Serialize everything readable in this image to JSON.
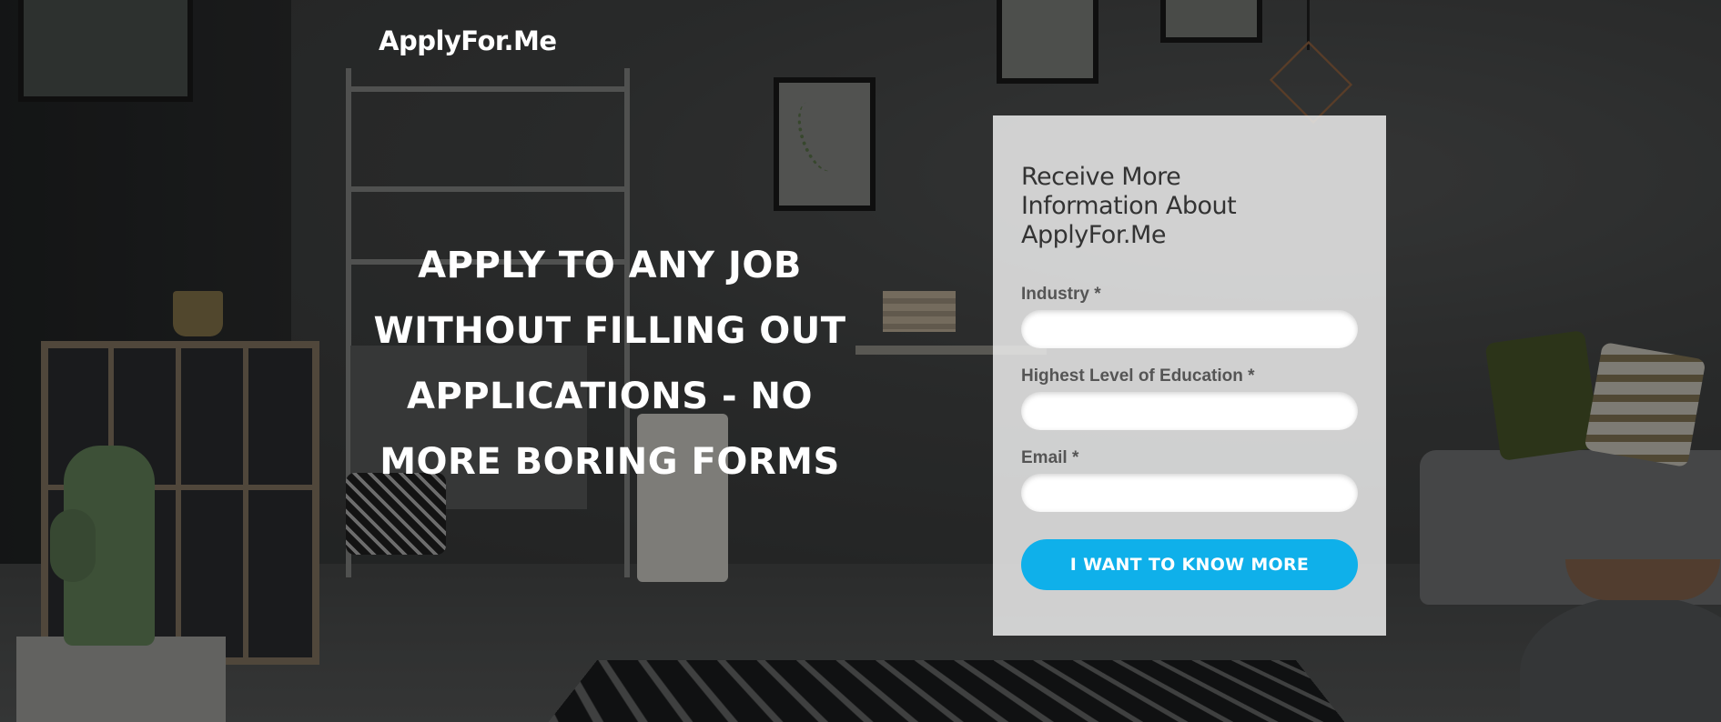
{
  "brand": {
    "logo_text": "ApplyFor.Me"
  },
  "hero": {
    "headline": "APPLY TO ANY JOB WITHOUT FILLING OUT APPLICATIONS - NO MORE BORING FORMS",
    "background_image": "living room interior with shelves, plants, cactus, sofa and patterned rug"
  },
  "form": {
    "title": "Receive More Information About ApplyFor.Me",
    "fields": [
      {
        "label": "Industry *",
        "value": "",
        "placeholder": ""
      },
      {
        "label": "Highest Level of Education *",
        "value": "",
        "placeholder": ""
      },
      {
        "label": "Email *",
        "value": "",
        "placeholder": ""
      }
    ],
    "submit_label": "I WANT TO KNOW MORE"
  },
  "colors": {
    "accent": "#0fb0ea",
    "text_light": "#ffffff",
    "form_label": "#555555",
    "form_title": "#333333"
  }
}
